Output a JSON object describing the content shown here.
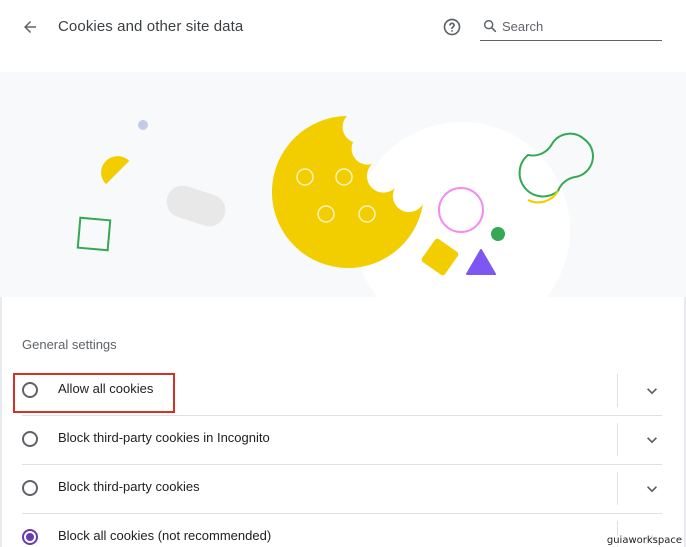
{
  "header": {
    "title": "Cookies and other site data",
    "back_icon": "arrow-back-icon",
    "help_icon": "help-circle-icon",
    "search": {
      "placeholder": "Search",
      "value": "",
      "icon": "search-icon"
    }
  },
  "illustration": {
    "description_icon": "cookie-illustration",
    "colors": {
      "yellow": "#f2ce00",
      "background": "#f8f9fa",
      "green": "#34a853",
      "pink": "#f48bf0",
      "purple": "#7e57f2",
      "gray": "#e8e8e8",
      "dot": "#c5cae9"
    }
  },
  "general_settings": {
    "heading": "General settings",
    "options": [
      {
        "label": "Allow all cookies",
        "selected": false
      },
      {
        "label": "Block third-party cookies in Incognito",
        "selected": false
      },
      {
        "label": "Block third-party cookies",
        "selected": false
      },
      {
        "label": "Block all cookies (not recommended)",
        "selected": true
      }
    ]
  },
  "annotation": {
    "highlight_color": "#d93025"
  },
  "watermark": "guiaworkspace",
  "colors": {
    "accent": "#673ab7",
    "text": "#202124",
    "secondary": "#5f6368"
  }
}
